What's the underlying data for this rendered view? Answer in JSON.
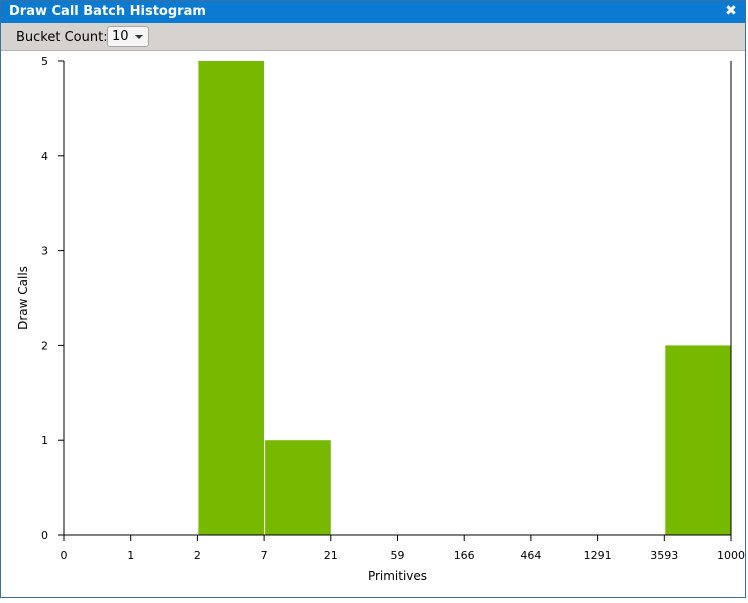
{
  "window": {
    "title": "Draw Call Batch Histogram"
  },
  "toolbar": {
    "bucket_label": "Bucket Count:",
    "bucket_value": "10"
  },
  "icons": {
    "close": "close-icon",
    "dropdown": "chevron-down-icon"
  },
  "colors": {
    "titlebar": "#0b7ad1",
    "bar": "#76b900",
    "toolbar": "#d6d2d0"
  },
  "chart_data": {
    "type": "bar",
    "xlabel": "Primitives",
    "ylabel": "Draw Calls",
    "bin_edges": [
      "0",
      "1",
      "2",
      "7",
      "21",
      "59",
      "166",
      "464",
      "1291",
      "3593",
      "1000"
    ],
    "values": [
      0,
      0,
      5,
      1,
      0,
      0,
      0,
      0,
      0,
      2
    ],
    "ylim": [
      0,
      5
    ],
    "yticks": [
      0,
      1,
      2,
      3,
      4,
      5
    ],
    "grid": false
  }
}
